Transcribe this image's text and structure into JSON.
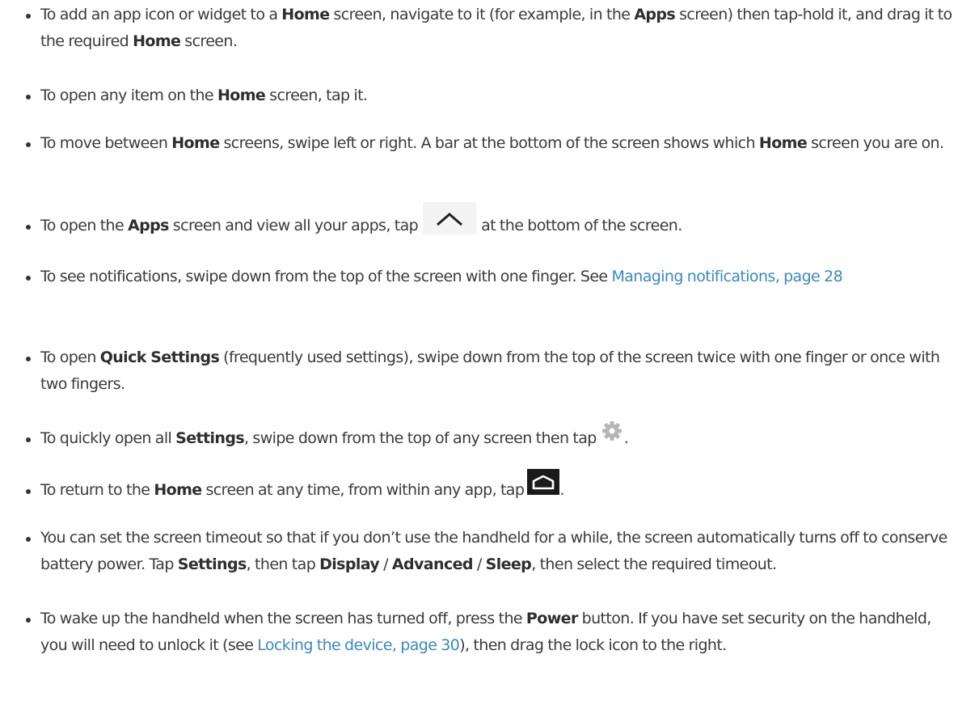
{
  "items": [
    {
      "t1": "To add an app icon or widget to a ",
      "b1": "Home",
      "t2": " screen, navigate to it (for example, in the ",
      "b2": "Apps",
      "t3": " screen) then tap-hold it, and drag it to the required ",
      "b3": "Home",
      "t4": " screen."
    },
    {
      "t1": "To open any item on the ",
      "b1": "Home",
      "t2": " screen, tap it."
    },
    {
      "t1": "To move between ",
      "b1": "Home",
      "t2": " screens, swipe left or right. A bar at the bottom of the screen shows which ",
      "b2": "Home",
      "t3": " screen you are on."
    },
    {
      "t1": "To open the ",
      "b1": "Apps",
      "t2": " screen and view all your apps, tap",
      "icon": "chevron-up-icon",
      "t3": "at the bottom of the screen."
    },
    {
      "t1": "To see notifications, swipe down from the top of the screen with one finger. See ",
      "link": "Managing notifications, page 28"
    },
    {
      "t1": "To open ",
      "b1": "Quick Settings",
      "t2": " (frequently used settings), swipe down from the top of the screen twice with one finger or once with two fingers."
    },
    {
      "t1": "To quickly open all ",
      "b1": "Settings",
      "t2": ", swipe down from the top of any screen then tap",
      "icon": "gear-icon",
      "t3": "."
    },
    {
      "t1": "To return to the ",
      "b1": "Home",
      "t2": " screen at any time, from within any app, tap",
      "icon": "home-icon",
      "t3": "."
    },
    {
      "t1": "You can set the screen timeout so that if you don’t use the handheld for a while, the screen automatically turns off to conserve battery power. Tap ",
      "b1": "Settings",
      "t2": ", then tap ",
      "b2": "Display",
      "t3": " / ",
      "b3": "Advanced",
      "t4": " / ",
      "b4": "Sleep",
      "t5": ", then select the required timeout."
    },
    {
      "t1": "To wake up the handheld when the screen has turned off, press the ",
      "b1": "Power",
      "t2": " button. If you have set security on the handheld, you will need to unlock it (see ",
      "link": "Locking the device, page 30",
      "t3": "), then drag the lock icon to the right."
    }
  ],
  "colors": {
    "text": "#3a3a3a",
    "link": "#3a88c0",
    "icon_dark": "#1a1a1a"
  }
}
